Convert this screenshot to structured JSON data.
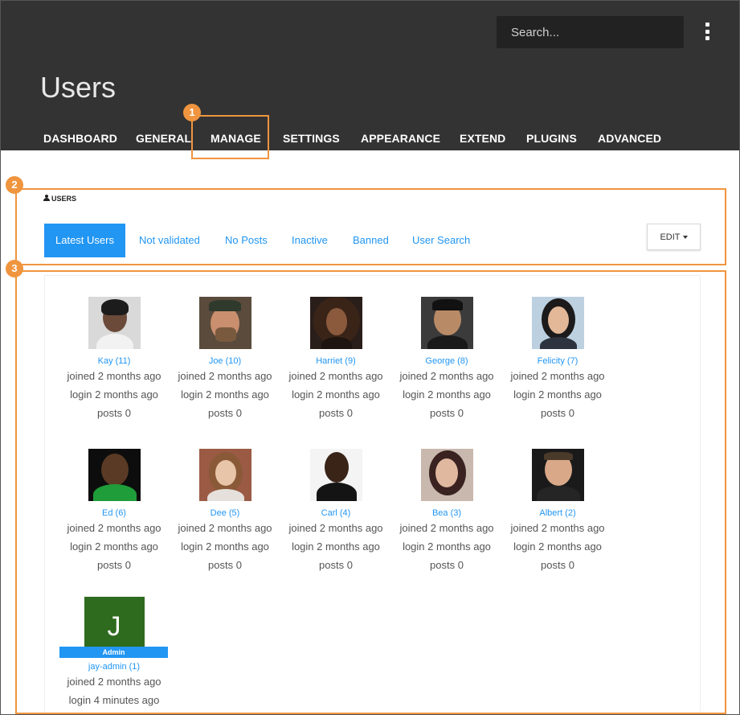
{
  "header": {
    "search_placeholder": "Search...",
    "page_title": "Users",
    "nav": [
      "DASHBOARD",
      "GENERAL",
      "MANAGE",
      "SETTINGS",
      "APPEARANCE",
      "EXTEND",
      "PLUGINS",
      "ADVANCED"
    ]
  },
  "callouts": [
    "1",
    "2",
    "3"
  ],
  "panel": {
    "label": "USERS",
    "tabs": [
      "Latest Users",
      "Not validated",
      "No Posts",
      "Inactive",
      "Banned",
      "User Search"
    ],
    "active_tab": "Latest Users",
    "edit_label": "EDIT"
  },
  "users": [
    {
      "name": "Kay (11)",
      "joined": "joined 2 months ago",
      "login": "login 2 months ago",
      "posts": "posts 0"
    },
    {
      "name": "Joe (10)",
      "joined": "joined 2 months ago",
      "login": "login 2 months ago",
      "posts": "posts 0"
    },
    {
      "name": "Harriet (9)",
      "joined": "joined 2 months ago",
      "login": "login 2 months ago",
      "posts": "posts 0"
    },
    {
      "name": "George (8)",
      "joined": "joined 2 months ago",
      "login": "login 2 months ago",
      "posts": "posts 0"
    },
    {
      "name": "Felicity (7)",
      "joined": "joined 2 months ago",
      "login": "login 2 months ago",
      "posts": "posts 0"
    },
    {
      "name": "Ed (6)",
      "joined": "joined 2 months ago",
      "login": "login 2 months ago",
      "posts": "posts 0"
    },
    {
      "name": "Dee (5)",
      "joined": "joined 2 months ago",
      "login": "login 2 months ago",
      "posts": "posts 0"
    },
    {
      "name": "Carl (4)",
      "joined": "joined 2 months ago",
      "login": "login 2 months ago",
      "posts": "posts 0"
    },
    {
      "name": "Bea (3)",
      "joined": "joined 2 months ago",
      "login": "login 2 months ago",
      "posts": "posts 0"
    },
    {
      "name": "Albert (2)",
      "joined": "joined 2 months ago",
      "login": "login 2 months ago",
      "posts": "posts 0"
    },
    {
      "name": "jay-admin (1)",
      "joined": "joined 2 months ago",
      "login": "login 4 minutes ago",
      "avatar_letter": "J",
      "badge": "Admin"
    }
  ],
  "colors": {
    "header_bg": "#333333",
    "accent": "#2196f3",
    "callout": "#f0953f",
    "letter_avatar_bg": "#2e6b1e"
  }
}
